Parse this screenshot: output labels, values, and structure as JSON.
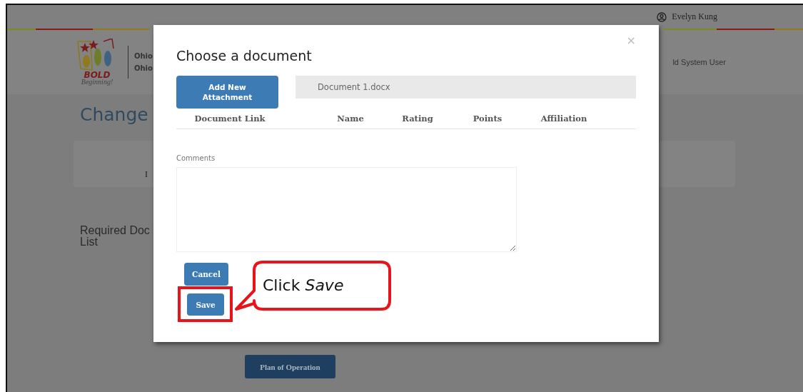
{
  "page": {
    "user_name": "Evelyn Kung",
    "logo_text": [
      "BOLD",
      "Beginning!"
    ],
    "org_lines": [
      "Ohio",
      "Ohio"
    ],
    "role": "ld System User",
    "heading": "Change",
    "card_text": "I",
    "section_heading": [
      "Required Doc",
      "List"
    ],
    "bottom_button": "Plan of Operation"
  },
  "modal": {
    "title": "Choose a document",
    "close": "×",
    "add_button": "Add New Attachment",
    "file_name": "Document 1.docx",
    "columns": [
      "Document Link",
      "Name",
      "Rating",
      "Points",
      "Affiliation"
    ],
    "comments_label": "Comments",
    "buttons": [
      {
        "label": "Cancel",
        "highlighted": false
      },
      {
        "label": "Save",
        "highlighted": true
      }
    ]
  },
  "callout": {
    "text": "Click *Save*"
  }
}
